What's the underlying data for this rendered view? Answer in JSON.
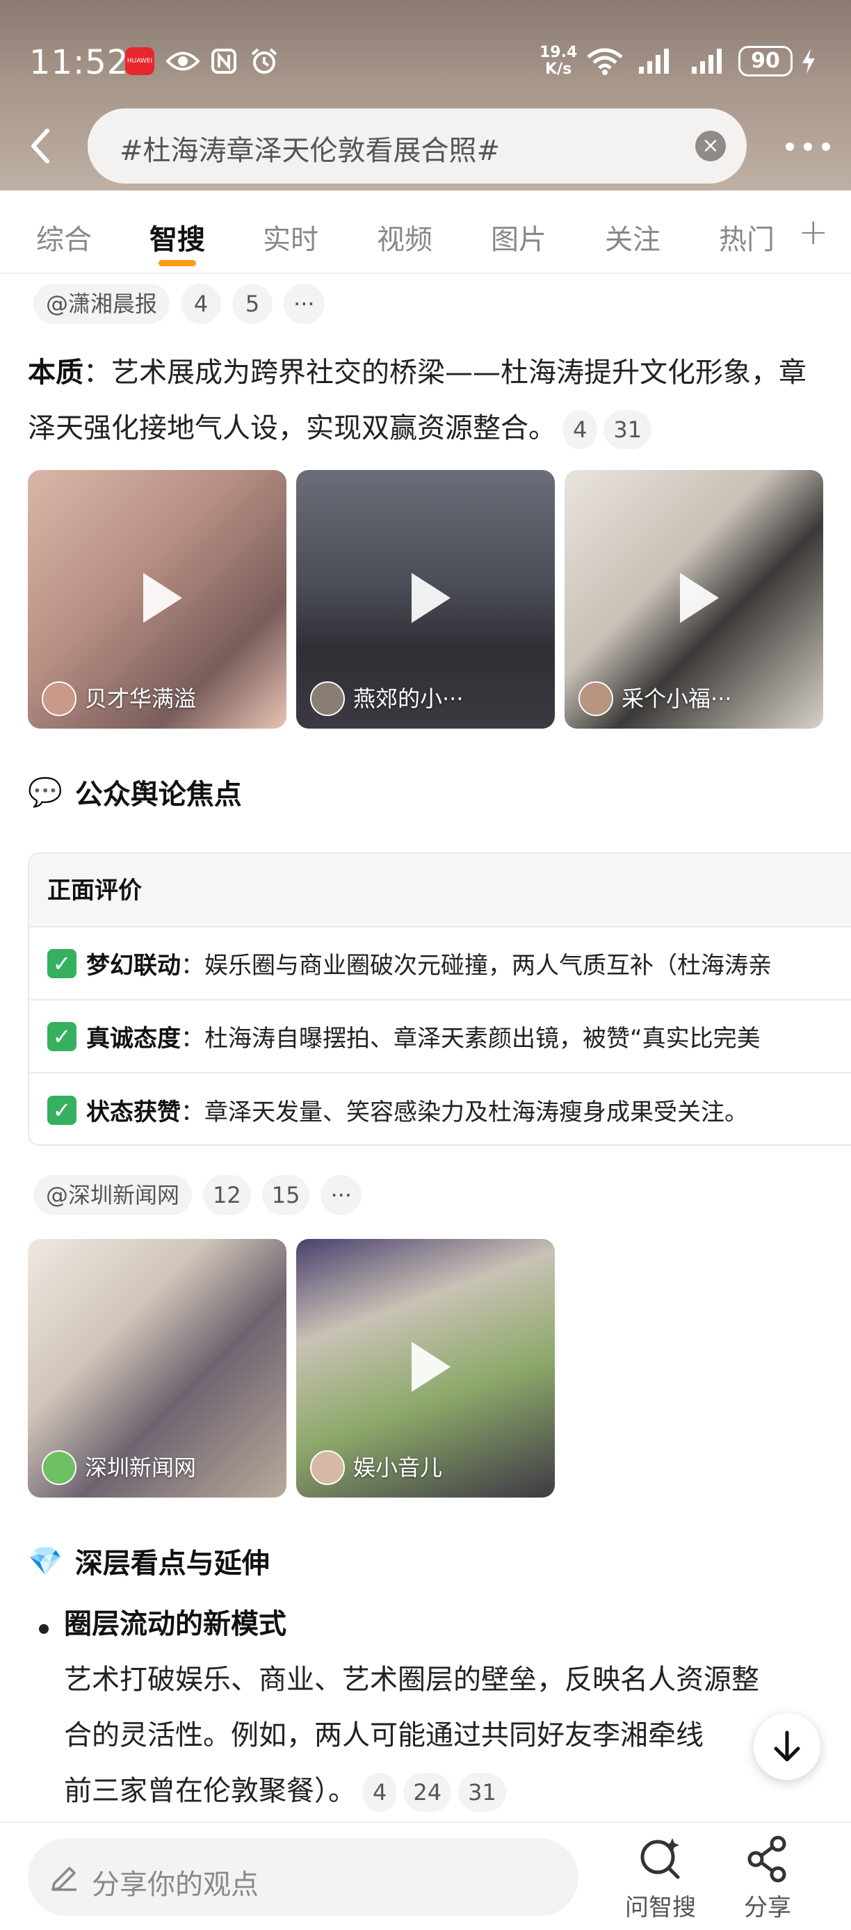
{
  "status_bar": {
    "time": "11:52",
    "speed": "19.4",
    "speed_unit": "K/s",
    "battery": "90"
  },
  "search": {
    "query": "#杜海涛章泽天伦敦看展合照#"
  },
  "tabs": [
    {
      "label": "综合"
    },
    {
      "label": "智搜"
    },
    {
      "label": "实时"
    },
    {
      "label": "视频"
    },
    {
      "label": "图片"
    },
    {
      "label": "关注"
    },
    {
      "label": "热门"
    }
  ],
  "source1": {
    "name": "@潇湘晨报",
    "ref_a": "4",
    "ref_b": "5",
    "more": "···"
  },
  "essence": {
    "label": "本质",
    "sep": "：",
    "text": "艺术展成为跨界社交的桥梁——杜海涛提升文化形象，章泽天强化接地气人设，实现双赢资源整合。",
    "ref_a": "4",
    "ref_b": "31"
  },
  "videos1": [
    {
      "author": "贝才华满溢"
    },
    {
      "author": "燕郊的小···"
    },
    {
      "author": "采个小福···"
    }
  ],
  "section_public": {
    "icon": "💬",
    "title": "公众舆论焦点"
  },
  "table": {
    "header": "正面评价",
    "rows": [
      {
        "bold": "梦幻联动",
        "sep": "：",
        "text": "娱乐圈与商业圈破次元碰撞，两人气质互补（杜海涛亲"
      },
      {
        "bold": "真诚态度",
        "sep": "：",
        "text": "杜海涛自曝摆拍、章泽天素颜出镜，被赞“真实比完美"
      },
      {
        "bold": "状态获赞",
        "sep": "：",
        "text": "章泽天发量、笑容感染力及杜海涛瘦身成果受关注。"
      }
    ]
  },
  "source2": {
    "name": "@深圳新闻网",
    "ref_a": "12",
    "ref_b": "15",
    "more": "···"
  },
  "videos2": [
    {
      "author": "深圳新闻网"
    },
    {
      "author": "娱小音儿"
    }
  ],
  "section_deep": {
    "icon": "💎",
    "title": "深层看点与延伸"
  },
  "bullet1": {
    "title": "圈层流动的新模式",
    "line1": "艺术打破娱乐、商业、艺术圈层的壁垒，反映名人资源整",
    "line2": "合的灵活性。例如，两人可能通过共同好友李湘牵线",
    "line3": "前三家曾在伦敦聚餐）。",
    "ref_a": "4",
    "ref_b": "24",
    "ref_c": "31"
  },
  "bottom_bar": {
    "placeholder": "分享你的观点",
    "ask_label": "问智搜",
    "share_label": "分享"
  }
}
